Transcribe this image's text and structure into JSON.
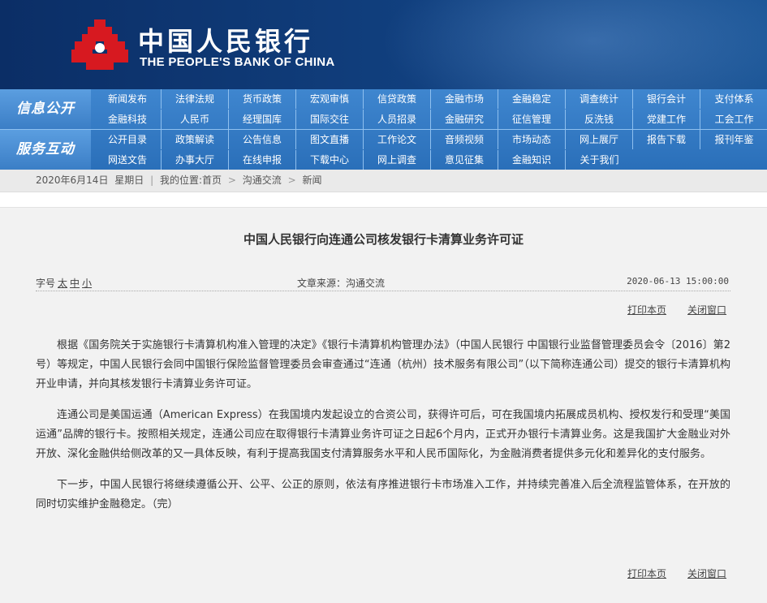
{
  "header": {
    "logo_cn": "中国人民银行",
    "logo_en": "THE PEOPLE'S BANK OF CHINA"
  },
  "nav": {
    "band1_label": "信息公开",
    "band2_label": "服务互动",
    "band1_row1": [
      "新闻发布",
      "法律法规",
      "货币政策",
      "宏观审慎",
      "信贷政策",
      "金融市场",
      "金融稳定",
      "调查统计",
      "银行会计",
      "支付体系"
    ],
    "band1_row2": [
      "金融科技",
      "人民币",
      "经理国库",
      "国际交往",
      "人员招录",
      "金融研究",
      "征信管理",
      "反洗钱",
      "党建工作",
      "工会工作"
    ],
    "band2_row1": [
      "公开目录",
      "政策解读",
      "公告信息",
      "图文直播",
      "工作论文",
      "音频视频",
      "市场动态",
      "网上展厅",
      "报告下载",
      "报刊年鉴"
    ],
    "band2_row2": [
      "网送文告",
      "办事大厅",
      "在线申报",
      "下载中心",
      "网上调查",
      "意见征集",
      "金融知识",
      "关于我们"
    ]
  },
  "breadcrumb": {
    "date": "2020年6月14日",
    "weekday": "星期日",
    "location_label": "我的位置:",
    "items": [
      "首页",
      "沟通交流",
      "新闻"
    ]
  },
  "article": {
    "title": "中国人民银行向连通公司核发银行卡清算业务许可证",
    "font_size_label": "字号",
    "font_sizes": [
      "太",
      "中",
      "小"
    ],
    "source": "文章来源：沟通交流",
    "datetime": "2020-06-13 15:00:00",
    "print_label": "打印本页",
    "close_label": "关闭窗口",
    "paragraphs": [
      "根据《国务院关于实施银行卡清算机构准入管理的决定》《银行卡清算机构管理办法》（中国人民银行 中国银行业监督管理委员会令〔2016〕第2号）等规定，中国人民银行会同中国银行保险监督管理委员会审查通过“连通（杭州）技术服务有限公司”（以下简称连通公司）提交的银行卡清算机构开业申请，并向其核发银行卡清算业务许可证。",
      "连通公司是美国运通（American Express）在我国境内发起设立的合资公司，获得许可后，可在我国境内拓展成员机构、授权发行和受理“美国运通”品牌的银行卡。按照相关规定，连通公司应在取得银行卡清算业务许可证之日起6个月内，正式开办银行卡清算业务。这是我国扩大金融业对外开放、深化金融供给侧改革的又一具体反映，有利于提高我国支付清算服务水平和人民币国际化，为金融消费者提供多元化和差异化的支付服务。",
      "下一步，中国人民银行将继续遵循公开、公平、公正的原则，依法有序推进银行卡市场准入工作，并持续完善准入后全流程监管体系，在开放的同时切实维护金融稳定。（完）"
    ]
  }
}
